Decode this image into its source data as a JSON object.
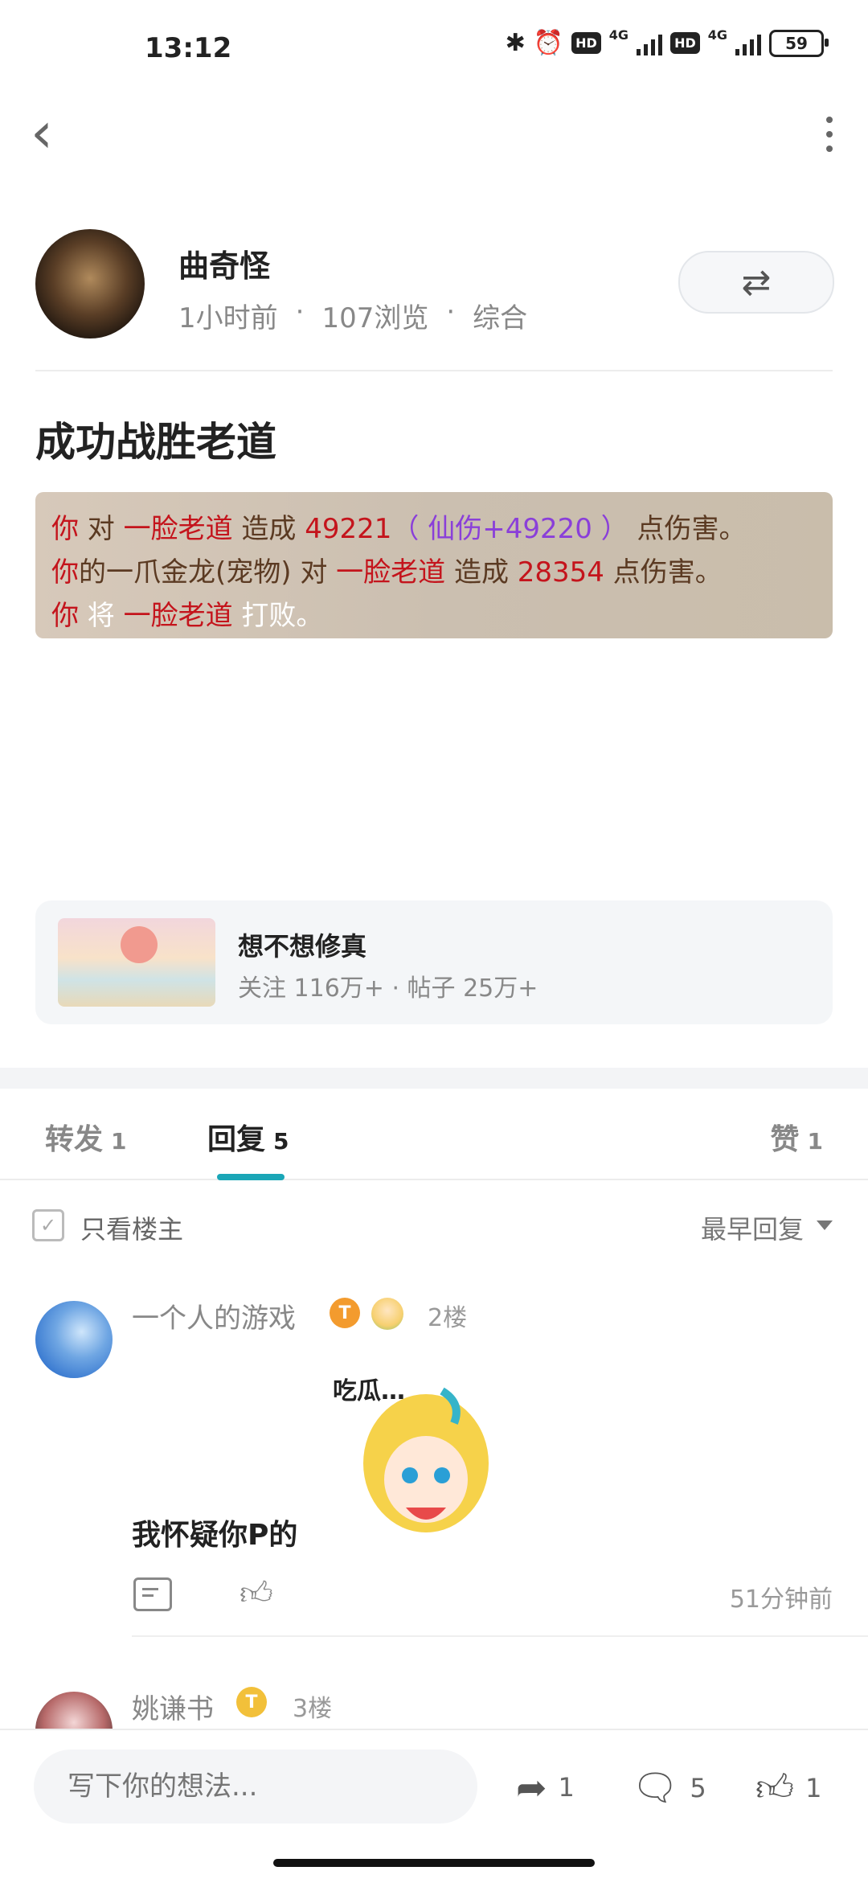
{
  "status_bar": {
    "time": "13:12",
    "net1": "4G",
    "net2": "4G",
    "hd": "HD",
    "battery": "59"
  },
  "post": {
    "author": "曲奇怪",
    "time_ago": "1小时前",
    "views": "107浏览",
    "category": "综合",
    "title": "成功战胜老道"
  },
  "game_log": {
    "l1_a": "你",
    "l1_b": " 对 ",
    "l1_c": "一脸老道",
    "l1_d": " 造成 ",
    "l1_e": "49221",
    "l1_f": "（ 仙伤+49220 ）",
    "l1_g": " 点伤害。",
    "l2_a": "你",
    "l2_b": "的一爪金龙(宠物) 对 ",
    "l2_c": "一脸老道",
    "l2_d": " 造成 ",
    "l2_e": "28354",
    "l2_f": " 点伤害。",
    "l3_a": "你",
    "l3_b": " 将 ",
    "l3_c": "一脸老道",
    "l3_d": " 打败。"
  },
  "topic": {
    "name": "想不想修真",
    "stats": "关注 116万+  ·  帖子 25万+"
  },
  "tabs": [
    {
      "label": "转发",
      "count": "1"
    },
    {
      "label": "回复",
      "count": "5"
    },
    {
      "label": "赞",
      "count": "1"
    }
  ],
  "filter": {
    "only_host": "只看楼主",
    "sort": "最早回复"
  },
  "comments": [
    {
      "name": "一个人的游戏",
      "level": "T",
      "floor": "2楼",
      "text": "我怀疑你P的",
      "time": "51分钟前",
      "sticker_text": "吃瓜…"
    },
    {
      "name": "姚谦书",
      "level": "T",
      "floor": "3楼"
    }
  ],
  "bottom_bar": {
    "placeholder": "写下你的想法...",
    "share_count": "1",
    "comment_count": "5",
    "like_count": "1"
  }
}
